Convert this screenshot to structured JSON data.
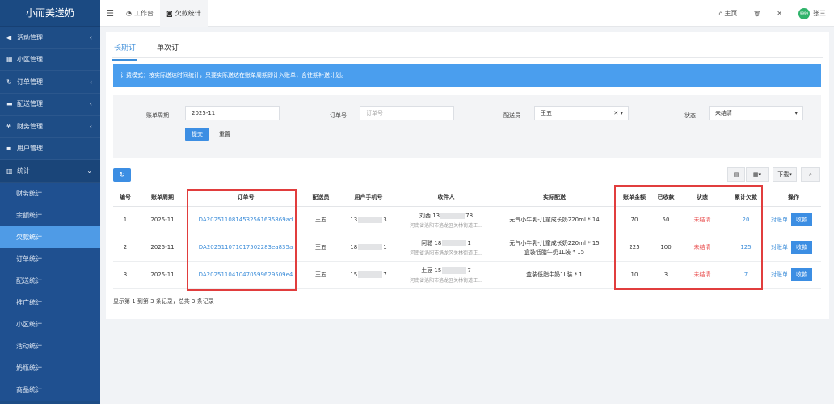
{
  "app": {
    "brand": "小而美送奶"
  },
  "sidebar": {
    "items": [
      {
        "label": "活动管理",
        "icon": "megaphone-icon",
        "glyph": "◀",
        "arrow": "‹"
      },
      {
        "label": "小区管理",
        "icon": "building-icon",
        "glyph": "▦",
        "arrow": ""
      },
      {
        "label": "订单管理",
        "icon": "refresh-icon",
        "glyph": "↻",
        "arrow": "‹"
      },
      {
        "label": "配送管理",
        "icon": "truck-icon",
        "glyph": "▬",
        "arrow": "‹"
      },
      {
        "label": "财务管理",
        "icon": "yen-icon",
        "glyph": "¥",
        "arrow": "‹"
      },
      {
        "label": "用户管理",
        "icon": "user-icon",
        "glyph": "▪",
        "arrow": ""
      },
      {
        "label": "统计",
        "icon": "bar-chart-icon",
        "glyph": "▥",
        "arrow": "⌄"
      }
    ],
    "sub_items": [
      "财务统计",
      "余额统计",
      "欠款统计",
      "订单统计",
      "配送统计",
      "推广统计",
      "小区统计",
      "活动统计",
      "奶瓶统计",
      "商品统计"
    ]
  },
  "topbar": {
    "tabs": [
      {
        "label": "工作台",
        "icon": "dashboard-icon",
        "glyph": "◔"
      },
      {
        "label": "欠款统计",
        "icon": "camera-icon",
        "glyph": "◙"
      }
    ],
    "home_label": "主页",
    "home_glyph": "⌂",
    "trash_glyph": "🗑",
    "expand_glyph": "✕",
    "avatar_text": "9999",
    "username": "张三"
  },
  "subtabs": [
    "长期订",
    "单次订"
  ],
  "notice": "计费模式：按实际送达时间统计，只要实际送达在账单周期即计入账单，含往期补送计划。",
  "filter": {
    "period_label": "账单周期",
    "period_value": "2025-11",
    "order_label": "订单号",
    "order_placeholder": "订单号",
    "courier_label": "配送员",
    "courier_value": "王五",
    "courier_suffix": "✕ ▾",
    "status_label": "状态",
    "status_value": "未结清",
    "status_suffix": "▾",
    "submit_label": "提交",
    "reset_label": "重置"
  },
  "toolbar": {
    "refresh_glyph": "↻",
    "list_glyph": "▤",
    "columns_glyph": "▦▾",
    "export_label": "下载▾",
    "search_glyph": "⌕"
  },
  "table": {
    "headers": [
      "编号",
      "账单周期",
      "订单号",
      "配送员",
      "用户手机号",
      "收件人",
      "实际配送",
      "账单金额",
      "已收款",
      "状态",
      "累计欠款",
      "操作"
    ],
    "rows": [
      {
        "id": "1",
        "period": "2025-11",
        "order_no": "DA202511081453256163586​9ad",
        "courier": "王五",
        "phone_pre": "13",
        "phone_suf": "3",
        "recipient": "刘西 13",
        "recipient_suf": "78",
        "address": "河南省洛阳市洛龙区关林街道正...",
        "delivery": "元气小牛乳-儿童成长奶220ml * 14",
        "delivery2": "",
        "amount": "70",
        "paid": "50",
        "status": "未结清",
        "debt": "20",
        "op_bill": "对账单",
        "op_pay": "收款"
      },
      {
        "id": "2",
        "period": "2025-11",
        "order_no": "DA202511071017502283ea835a",
        "courier": "王五",
        "phone_pre": "18",
        "phone_suf": "1",
        "recipient": "阿聪 18",
        "recipient_suf": "1",
        "address": "河南省洛阳市洛龙区关林街道正...",
        "delivery": "元气小牛乳-儿童成长奶220ml * 15",
        "delivery2": "盒装低脂牛奶1L装 * 15",
        "amount": "225",
        "paid": "100",
        "status": "未结清",
        "debt": "125",
        "op_bill": "对账单",
        "op_pay": "收款"
      },
      {
        "id": "3",
        "period": "2025-11",
        "order_no": "DA202511041047059962950​9e4",
        "courier": "王五",
        "phone_pre": "15",
        "phone_suf": "7",
        "recipient": "土豆 15",
        "recipient_suf": "7",
        "address": "河南省洛阳市洛龙区关林街道正...",
        "delivery": "盒装低脂牛奶1L装 * 1",
        "delivery2": "",
        "amount": "10",
        "paid": "3",
        "status": "未结清",
        "debt": "7",
        "op_bill": "对账单",
        "op_pay": "收款"
      }
    ],
    "footer": "显示第 1 到第 3 条记录，总共 3 条记录"
  },
  "colors": {
    "sidebar": "#1e4d86",
    "active": "#4f9be6",
    "primary": "#3c8ee3",
    "notice": "#4a9eee",
    "highlight": "#e13d3d",
    "debt_status": "#e84b4b"
  }
}
